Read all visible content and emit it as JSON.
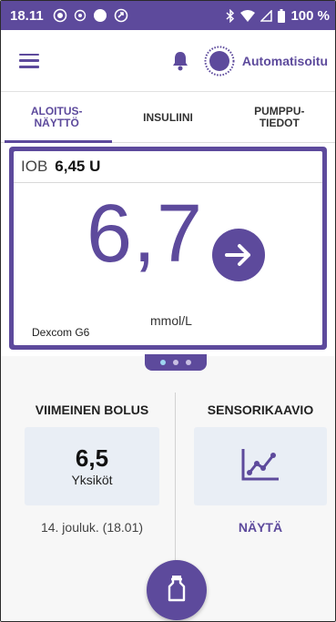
{
  "status_bar": {
    "time": "18.11",
    "battery": "100 %"
  },
  "app_bar": {
    "mode_label": "Automatisoitu"
  },
  "tabs": [
    {
      "label": "ALOITUS-\nNÄYTTÖ",
      "active": true
    },
    {
      "label": "INSULIINI",
      "active": false
    },
    {
      "label": "PUMPPU-\nTIEDOT",
      "active": false
    }
  ],
  "glucose_card": {
    "iob_label": "IOB",
    "iob_value": "6,45 U",
    "value": "6,7",
    "unit": "mmol/L",
    "source": "Dexcom G6",
    "trend": "arrow-right-icon",
    "pager": {
      "pages": 3,
      "current": 1
    }
  },
  "last_bolus": {
    "title": "VIIMEINEN BOLUS",
    "value": "6,5",
    "unit": "Yksiköt",
    "date": "14. jouluk. (18.01)"
  },
  "sensor_graph": {
    "title": "SENSORIKAAVIO",
    "link": "NÄYTÄ",
    "icon": "trend-chart-icon"
  },
  "colors": {
    "primary": "#5d4a9c",
    "tile": "#e9eef5",
    "pager_dot_active": "#9ed6f0"
  }
}
